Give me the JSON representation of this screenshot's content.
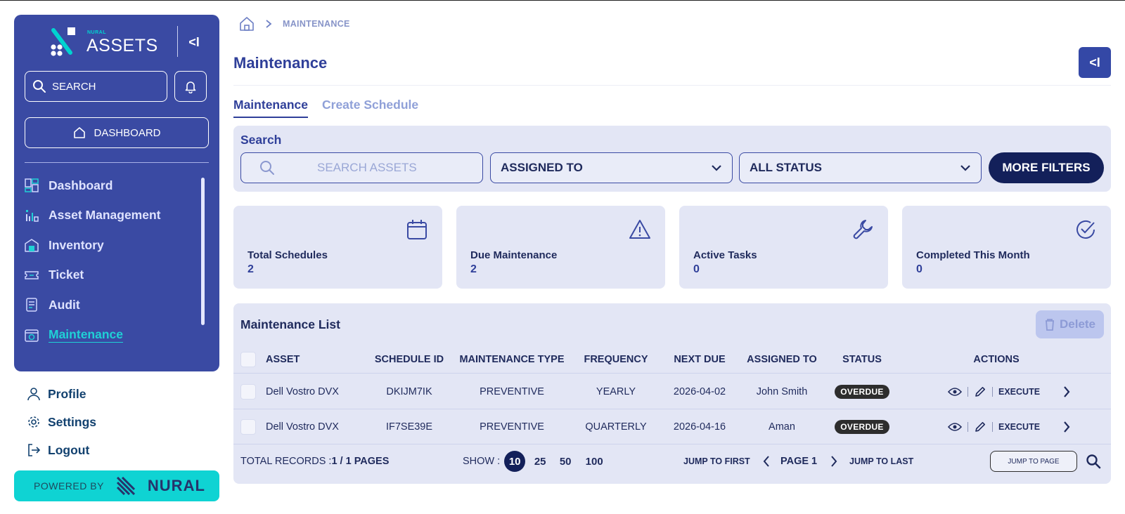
{
  "brand": {
    "small": "NURAL",
    "name": "ASSETS",
    "collapse_label": "<I"
  },
  "sidebar": {
    "search_placeholder": "SEARCH",
    "dashboard_button": "DASHBOARD",
    "items": [
      {
        "label": "Dashboard",
        "icon": "dashboard-icon"
      },
      {
        "label": "Asset Management",
        "icon": "asset-management-icon"
      },
      {
        "label": "Inventory",
        "icon": "inventory-icon"
      },
      {
        "label": "Ticket",
        "icon": "ticket-icon"
      },
      {
        "label": "Audit",
        "icon": "audit-icon"
      },
      {
        "label": "Maintenance",
        "icon": "maintenance-icon",
        "active": true
      }
    ],
    "bottom_links": [
      {
        "label": "Profile",
        "icon": "user-icon"
      },
      {
        "label": "Settings",
        "icon": "gear-icon"
      },
      {
        "label": "Logout",
        "icon": "logout-icon"
      }
    ],
    "powered_by": "POWERED BY",
    "powered_brand": "NURAL"
  },
  "breadcrumb": {
    "current": "MAINTENANCE"
  },
  "page": {
    "title": "Maintenance",
    "collapse_label": "<I"
  },
  "tabs": [
    "Maintenance",
    "Create Schedule"
  ],
  "search": {
    "label": "Search",
    "placeholder": "SEARCH ASSETS",
    "assigned_to": "ASSIGNED TO",
    "status": "ALL STATUS",
    "more_filters": "MORE FILTERS"
  },
  "stats": [
    {
      "label": "Total Schedules",
      "value": "2",
      "icon": "calendar-icon"
    },
    {
      "label": "Due Maintenance",
      "value": "2",
      "icon": "warning-icon"
    },
    {
      "label": "Active Tasks",
      "value": "0",
      "icon": "wrench-icon"
    },
    {
      "label": "Completed This Month",
      "value": "0",
      "icon": "check-circle-icon"
    }
  ],
  "list": {
    "title": "Maintenance List",
    "delete_label": "Delete",
    "columns": [
      "ASSET",
      "SCHEDULE ID",
      "MAINTENANCE TYPE",
      "FREQUENCY",
      "NEXT DUE",
      "ASSIGNED TO",
      "STATUS",
      "ACTIONS"
    ],
    "rows": [
      {
        "asset": "Dell Vostro DVX",
        "schedule_id": "DKIJM7IK",
        "type": "PREVENTIVE",
        "frequency": "YEARLY",
        "next_due": "2026-04-02",
        "assigned_to": "John Smith",
        "status": "OVERDUE",
        "execute": "EXECUTE"
      },
      {
        "asset": "Dell Vostro DVX",
        "schedule_id": "IF7SE39E",
        "type": "PREVENTIVE",
        "frequency": "QUARTERLY",
        "next_due": "2026-04-16",
        "assigned_to": "Aman",
        "status": "OVERDUE",
        "execute": "EXECUTE"
      }
    ]
  },
  "pagination": {
    "total_label": "TOTAL RECORDS : ",
    "total_value": "1 / 1 PAGES",
    "show_label": "SHOW :",
    "sizes": [
      "10",
      "25",
      "50",
      "100"
    ],
    "active_size": "10",
    "jump_first": "JUMP TO FIRST",
    "page_label": "PAGE 1",
    "jump_last": "JUMP TO LAST",
    "jump_to_page": "JUMP TO PAGE"
  },
  "colors": {
    "primary": "#3a4aa3",
    "accent": "#0fd3d3",
    "dark": "#13205a",
    "panel": "#e3e6f5"
  }
}
